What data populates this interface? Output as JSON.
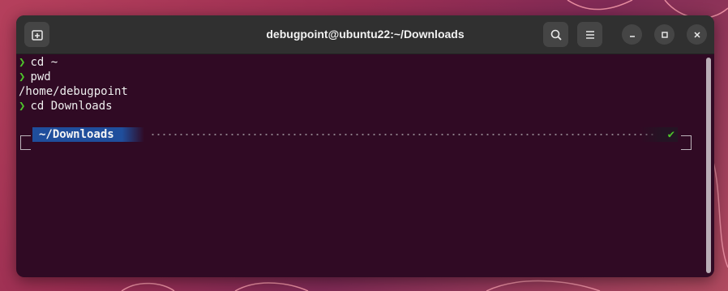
{
  "window": {
    "title": "debugpoint@ubuntu22:~/Downloads"
  },
  "toolbar": {
    "new_tab_icon": "new-tab-icon",
    "search_icon": "search-icon",
    "menu_icon": "hamburger-menu-icon"
  },
  "window_controls": {
    "minimize_icon": "minimize-icon",
    "maximize_icon": "maximize-icon",
    "close_icon": "close-icon"
  },
  "terminal": {
    "prompt_symbol": "❯",
    "lines": [
      {
        "command": "cd ~"
      },
      {
        "command": "pwd"
      },
      {
        "output": "/home/debugpoint"
      },
      {
        "command": "cd Downloads"
      }
    ],
    "prompt": {
      "directory": "~/Downloads",
      "status_symbol": "✔"
    }
  },
  "colors": {
    "terminal_bg": "#300a24",
    "prompt_chevron": "#4ec42b",
    "directory_segment": "#1f4e9c",
    "titlebar": "#303030"
  }
}
